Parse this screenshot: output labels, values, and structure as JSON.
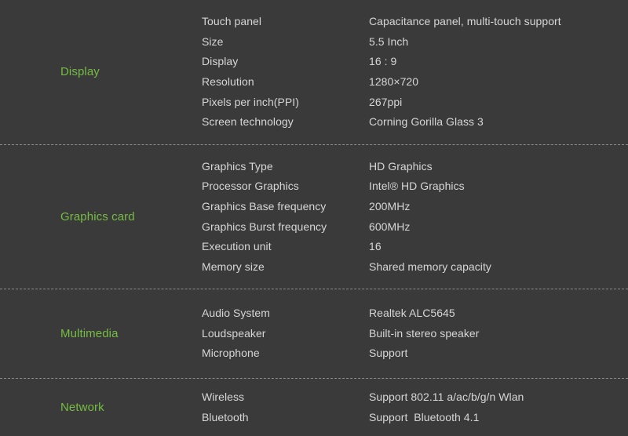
{
  "page": {
    "background_color": "#3a3a3a",
    "accent_color": "#76bc45",
    "text_color": "#d6d6d6",
    "divider_color": "#8c8c8c"
  },
  "sections": [
    {
      "id": "display",
      "label": "Display",
      "rows": [
        {
          "key": "Touch panel",
          "value": "Capacitance panel, multi-touch support"
        },
        {
          "key": "Size",
          "value": "5.5 Inch"
        },
        {
          "key": "Display",
          "value": "16 : 9"
        },
        {
          "key": "Resolution",
          "value": "1280×720"
        },
        {
          "key": "Pixels per inch(PPI)",
          "value": "267ppi"
        },
        {
          "key": "Screen technology",
          "value": "Corning Gorilla Glass 3"
        }
      ]
    },
    {
      "id": "graphics",
      "label": "Graphics card",
      "rows": [
        {
          "key": "Graphics Type",
          "value": "HD Graphics"
        },
        {
          "key": "Processor Graphics",
          "value": "Intel® HD Graphics"
        },
        {
          "key": "Graphics Base frequency",
          "value": "200MHz"
        },
        {
          "key": "Graphics Burst frequency",
          "value": "600MHz"
        },
        {
          "key": "Execution unit",
          "value": "16"
        },
        {
          "key": "Memory size",
          "value": "Shared memory capacity"
        }
      ]
    },
    {
      "id": "multimedia",
      "label": "Multimedia",
      "rows": [
        {
          "key": "Audio System",
          "value": "Realtek ALC5645"
        },
        {
          "key": "Loudspeaker",
          "value": "Built-in stereo speaker"
        },
        {
          "key": "Microphone",
          "value": "Support"
        }
      ]
    },
    {
      "id": "network",
      "label": "Network",
      "rows": [
        {
          "key": "Wireless",
          "value": "Support 802.11 a/ac/b/g/n Wlan"
        },
        {
          "key": "Bluetooth",
          "value": "Support  Bluetooth 4.1"
        }
      ]
    }
  ]
}
